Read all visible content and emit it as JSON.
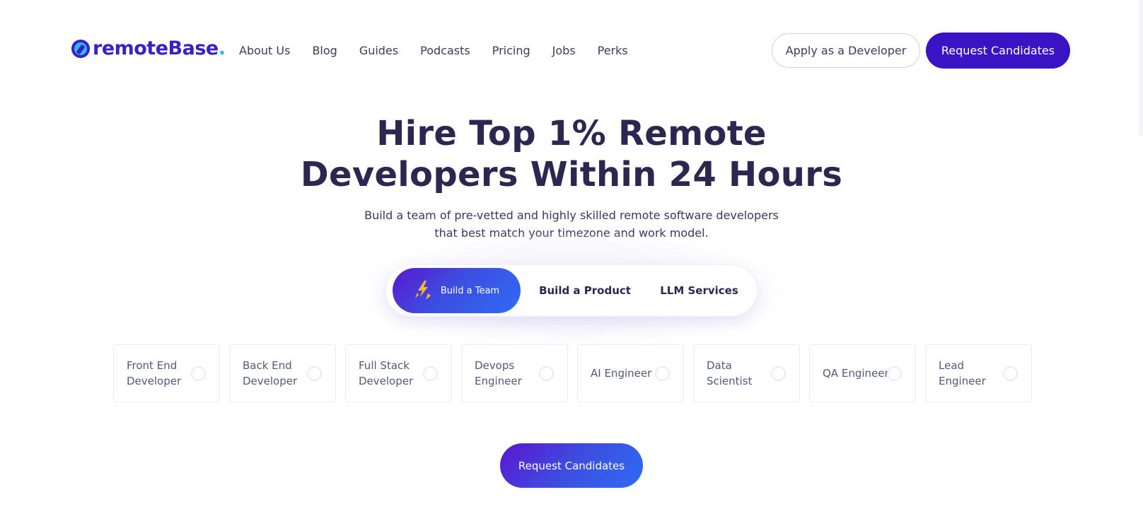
{
  "brand": {
    "name": "remoteBase",
    "dot": ".",
    "colors": {
      "primary": "#3a14c4",
      "accent": "#26b6f0",
      "gradient_start": "#5b16cf",
      "gradient_end": "#2e6cf5",
      "text_dark": "#2c2750"
    }
  },
  "nav": {
    "items": [
      {
        "label": "About Us"
      },
      {
        "label": "Blog"
      },
      {
        "label": "Guides"
      },
      {
        "label": "Podcasts"
      },
      {
        "label": "Pricing"
      },
      {
        "label": "Jobs"
      },
      {
        "label": "Perks"
      }
    ],
    "apply_label": "Apply as a Developer",
    "request_label": "Request Candidates"
  },
  "hero": {
    "title_line1": "Hire Top 1% Remote",
    "title_line2": "Developers Within 24 Hours",
    "subtitle_line1": "Build a team of pre-vetted and highly skilled remote software developers",
    "subtitle_line2": "that best match your timezone and work model."
  },
  "toggle": {
    "tabs": [
      {
        "label": "Build a Team",
        "icon": "lightning-icon",
        "active": true
      },
      {
        "label": "Build a Product",
        "active": false
      },
      {
        "label": "LLM Services",
        "active": false
      }
    ]
  },
  "roles": [
    {
      "label": "Front End Developer",
      "selected": false
    },
    {
      "label": "Back End Developer",
      "selected": false
    },
    {
      "label": "Full Stack Developer",
      "selected": false
    },
    {
      "label": "Devops Engineer",
      "selected": false
    },
    {
      "label": "AI Engineer",
      "selected": false
    },
    {
      "label": "Data Scientist",
      "selected": false
    },
    {
      "label": "QA Engineer",
      "selected": false
    },
    {
      "label": "Lead Engineer",
      "selected": false
    }
  ],
  "cta": {
    "label": "Request Candidates"
  }
}
